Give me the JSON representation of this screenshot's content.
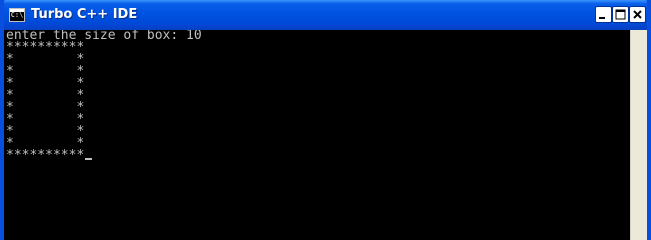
{
  "window": {
    "title": "Turbo C++ IDE",
    "icon": "console-icon",
    "icon_label": "C:\\",
    "controls": {
      "minimize": "minimize-icon",
      "maximize": "maximize-icon",
      "close": "close-icon"
    }
  },
  "console": {
    "prompt_line": "enter the size of box: 10",
    "output_lines": [
      "",
      "**********",
      "*        *",
      "*        *",
      "*        *",
      "*        *",
      "*        *",
      "*        *",
      "*        *",
      "*        *",
      "**********"
    ]
  },
  "colors": {
    "titlebar": "#0054e3",
    "console_background": "#000000",
    "console_text": "#c0c0c0"
  }
}
